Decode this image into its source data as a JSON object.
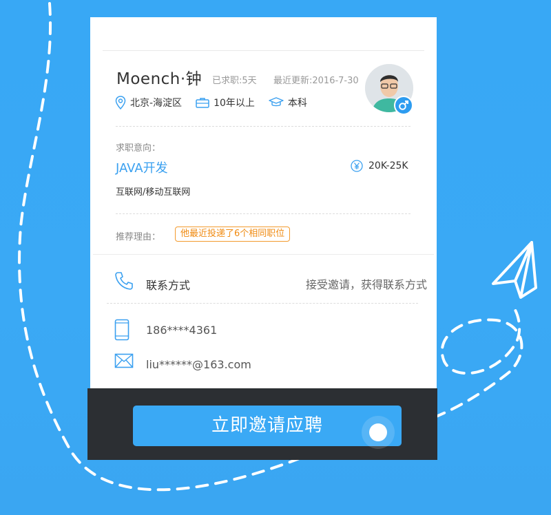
{
  "candidate": {
    "name": "Moench·钟",
    "job_search_duration": "已求职:5天",
    "last_update": "最近更新:2016-7-30",
    "location": "北京-海淀区",
    "experience": "10年以上",
    "education": "本科",
    "gender_icon": "male-icon"
  },
  "intent": {
    "label": "求职意向：",
    "title": "JAVA开发",
    "salary": "20K-25K",
    "industry": "互联网/移动互联网"
  },
  "recommendation": {
    "label": "推荐理由：",
    "reason": "他最近投递了6个相同职位"
  },
  "contact": {
    "label": "联系方式",
    "hint": "接受邀请，获得联系方式",
    "phone": "186****4361",
    "email": "liu******@163.com"
  },
  "cta": {
    "label": "立即邀请应聘"
  },
  "colors": {
    "background": "#38a8f5",
    "accent": "#3aa0f0",
    "tag_orange": "#f08a10",
    "footer": "#2c2f33"
  },
  "icons": [
    "location-icon",
    "briefcase-icon",
    "graduation-cap-icon",
    "male-icon",
    "yen-icon",
    "phone-icon",
    "mobile-icon",
    "mail-icon",
    "paper-plane-icon"
  ]
}
